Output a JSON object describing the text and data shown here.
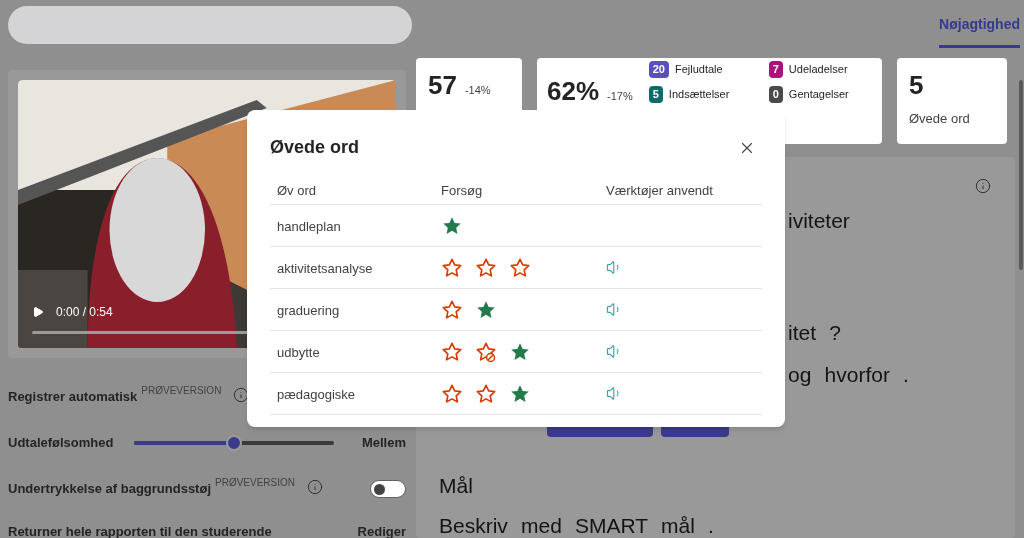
{
  "header": {
    "tabs": [
      {
        "label": "Nøjagtighed",
        "selected": true
      }
    ]
  },
  "video": {
    "time": "0:00 / 0:54"
  },
  "settings": [
    {
      "kind": "text",
      "label": "Registrer automatisk",
      "badge": "PRØVEVERSION",
      "info": true
    },
    {
      "kind": "slider",
      "label": "Udtalefølsomhed",
      "level": 0.5,
      "value": "Mellem"
    },
    {
      "kind": "toggle",
      "label": "Undertrykkelse af baggrundsstøj",
      "badge": "PRØVEVERSION",
      "info": true,
      "on": false
    },
    {
      "kind": "action",
      "label": "Returner hele rapporten til den studerende",
      "action": "Rediger"
    }
  ],
  "stats": [
    {
      "kind": "count",
      "value": "57",
      "change": "-14%"
    },
    {
      "kind": "breakdown",
      "value": "62%",
      "change": "-17%",
      "legend": [
        {
          "count": "20",
          "label": "Fejludtale",
          "color": "#5a50bc"
        },
        {
          "count": "7",
          "label": "Udeladelser",
          "color": "#a8127a"
        },
        {
          "count": "5",
          "label": "Indsættelser",
          "color": "#0d6a6c"
        },
        {
          "count": "0",
          "label": "Gentagelser",
          "color": "#4a4a4a"
        }
      ]
    },
    {
      "kind": "count",
      "value": "5",
      "label": "Øvede ord"
    }
  ],
  "content": {
    "intro": [
      "iviteter"
    ],
    "question": [
      "itet ?",
      "og hvorfor ."
    ],
    "section": {
      "heading": "Mål",
      "text": "Beskriv med SMART mål ."
    }
  },
  "dialog": {
    "title": "Øvede ord",
    "columns": [
      "Øv ord",
      "Forsøg",
      "Værktøjer anvendt"
    ],
    "rows": [
      {
        "word": "handleplan",
        "attempts": [
          {
            "kind": "correct"
          }
        ]
      },
      {
        "word": "aktivitetsanalyse",
        "attempts": [
          {
            "kind": "incorrect"
          },
          {
            "kind": "incorrect"
          },
          {
            "kind": "incorrect"
          }
        ],
        "tools": [
          {
            "kind": "audio"
          }
        ]
      },
      {
        "word": "graduering",
        "attempts": [
          {
            "kind": "incorrect"
          },
          {
            "kind": "correct"
          }
        ],
        "tools": [
          {
            "kind": "audio"
          }
        ]
      },
      {
        "word": "udbytte",
        "attempts": [
          {
            "kind": "incorrect"
          },
          {
            "kind": "blocked"
          },
          {
            "kind": "correct"
          }
        ],
        "tools": [
          {
            "kind": "audio"
          }
        ]
      },
      {
        "word": "pædagogiske",
        "attempts": [
          {
            "kind": "incorrect"
          },
          {
            "kind": "incorrect"
          },
          {
            "kind": "correct"
          }
        ],
        "tools": [
          {
            "kind": "audio"
          }
        ]
      }
    ]
  }
}
